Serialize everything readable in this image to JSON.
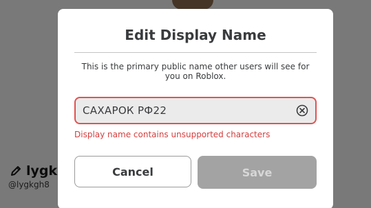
{
  "background": {
    "display_name": "lygkg",
    "username": "@lygkgh8"
  },
  "modal": {
    "title": "Edit Display Name",
    "description": "This is the primary public name other users will see for you on Roblox.",
    "input_value": "САХАРОК РФ22",
    "error_message": "Display name contains unsupported characters",
    "cancel_label": "Cancel",
    "save_label": "Save"
  },
  "icons": {
    "edit": "pencil-icon",
    "clear": "clear-circle-icon"
  },
  "colors": {
    "error": "#d63d3d",
    "error_border": "#e05252",
    "disabled_button": "#a3a3a3"
  }
}
